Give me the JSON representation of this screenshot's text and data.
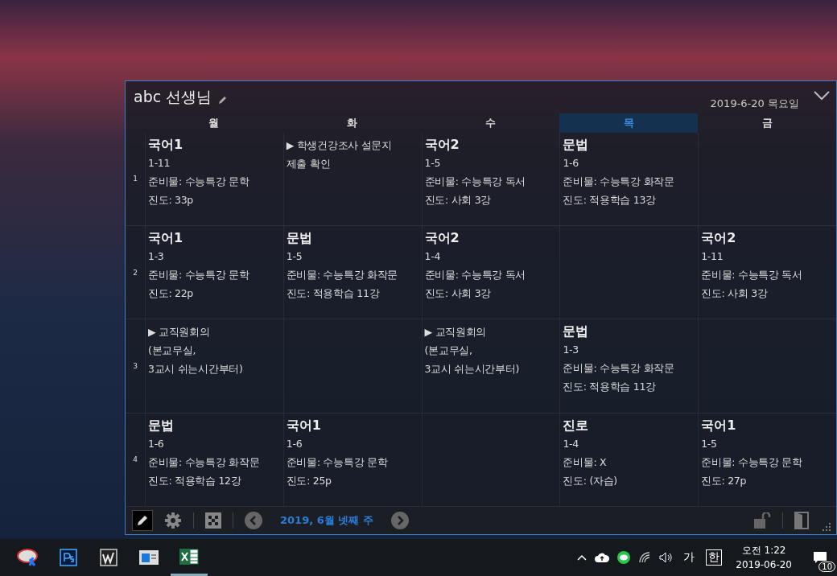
{
  "widget": {
    "title": "abc 선생님",
    "date": "2019-6-20 목요일",
    "days": [
      {
        "label": "월",
        "selected": false
      },
      {
        "label": "화",
        "selected": false
      },
      {
        "label": "수",
        "selected": false
      },
      {
        "label": "목",
        "selected": true
      },
      {
        "label": "금",
        "selected": false
      }
    ],
    "periods": [
      {
        "number": "1",
        "cells": [
          {
            "kind": "class",
            "subject": "국어1",
            "class": "1-11",
            "prep": "준비물: 수능특강 문학",
            "progress": "진도: 33p"
          },
          {
            "kind": "note",
            "lines": [
              "▶ 학생건강조사 설문지",
              "제출 확인"
            ]
          },
          {
            "kind": "class",
            "subject": "국어2",
            "class": "1-5",
            "prep": "준비물: 수능특강 독서",
            "progress": "진도: 사회 3강"
          },
          {
            "kind": "class",
            "subject": "문법",
            "class": "1-6",
            "prep": "준비물: 수능특강 화작문",
            "progress": "진도: 적용학습 13강"
          },
          {
            "kind": "empty"
          }
        ]
      },
      {
        "number": "2",
        "cells": [
          {
            "kind": "class",
            "subject": "국어1",
            "class": "1-3",
            "prep": "준비물: 수능특강 문학",
            "progress": "진도: 22p"
          },
          {
            "kind": "class",
            "subject": "문법",
            "class": "1-5",
            "prep": "준비물: 수능특강 화작문",
            "progress": "진도: 적용학습 11강"
          },
          {
            "kind": "class",
            "subject": "국어2",
            "class": "1-4",
            "prep": "준비물: 수능특강 독서",
            "progress": "진도: 사회 3강"
          },
          {
            "kind": "empty"
          },
          {
            "kind": "class",
            "subject": "국어2",
            "class": "1-11",
            "prep": "준비물: 수능특강 독서",
            "progress": "진도: 사회 3강"
          }
        ]
      },
      {
        "number": "3",
        "cells": [
          {
            "kind": "note",
            "lines": [
              "▶ 교직원회의",
              "(본교무실,",
              "3교시 쉬는시간부터)"
            ]
          },
          {
            "kind": "empty"
          },
          {
            "kind": "note",
            "lines": [
              "▶ 교직원회의",
              "(본교무실,",
              "3교시 쉬는시간부터)"
            ]
          },
          {
            "kind": "class",
            "subject": "문법",
            "class": "1-3",
            "prep": "준비물: 수능특강 화작문",
            "progress": "진도: 적용학습 11강"
          },
          {
            "kind": "empty"
          }
        ]
      },
      {
        "number": "4",
        "cells": [
          {
            "kind": "class",
            "subject": "문법",
            "class": "1-6",
            "prep": "준비물: 수능특강 화작문",
            "progress": "진도: 적용학습 12강"
          },
          {
            "kind": "class",
            "subject": "국어1",
            "class": "1-6",
            "prep": "준비물: 수능특강 문학",
            "progress": "진도: 25p"
          },
          {
            "kind": "empty"
          },
          {
            "kind": "class",
            "subject": "진로",
            "class": "1-4",
            "prep": "준비물: X",
            "progress": "진도: (자습)"
          },
          {
            "kind": "class",
            "subject": "국어1",
            "class": "1-5",
            "prep": "준비물: 수능특강 문학",
            "progress": "진도: 27p"
          }
        ]
      }
    ],
    "week": "2019, 6월 넷째 주"
  },
  "taskbar": {
    "apps": [
      {
        "kind": "snip",
        "selected": false
      },
      {
        "kind": "ps",
        "selected": false
      },
      {
        "kind": "word",
        "selected": false
      },
      {
        "kind": "window",
        "selected": false
      },
      {
        "kind": "excel",
        "selected": true
      }
    ],
    "ime_mode": "가",
    "ime_lang": "한",
    "time": "오전 1:22",
    "date": "2019-06-20",
    "notifications": "10"
  }
}
